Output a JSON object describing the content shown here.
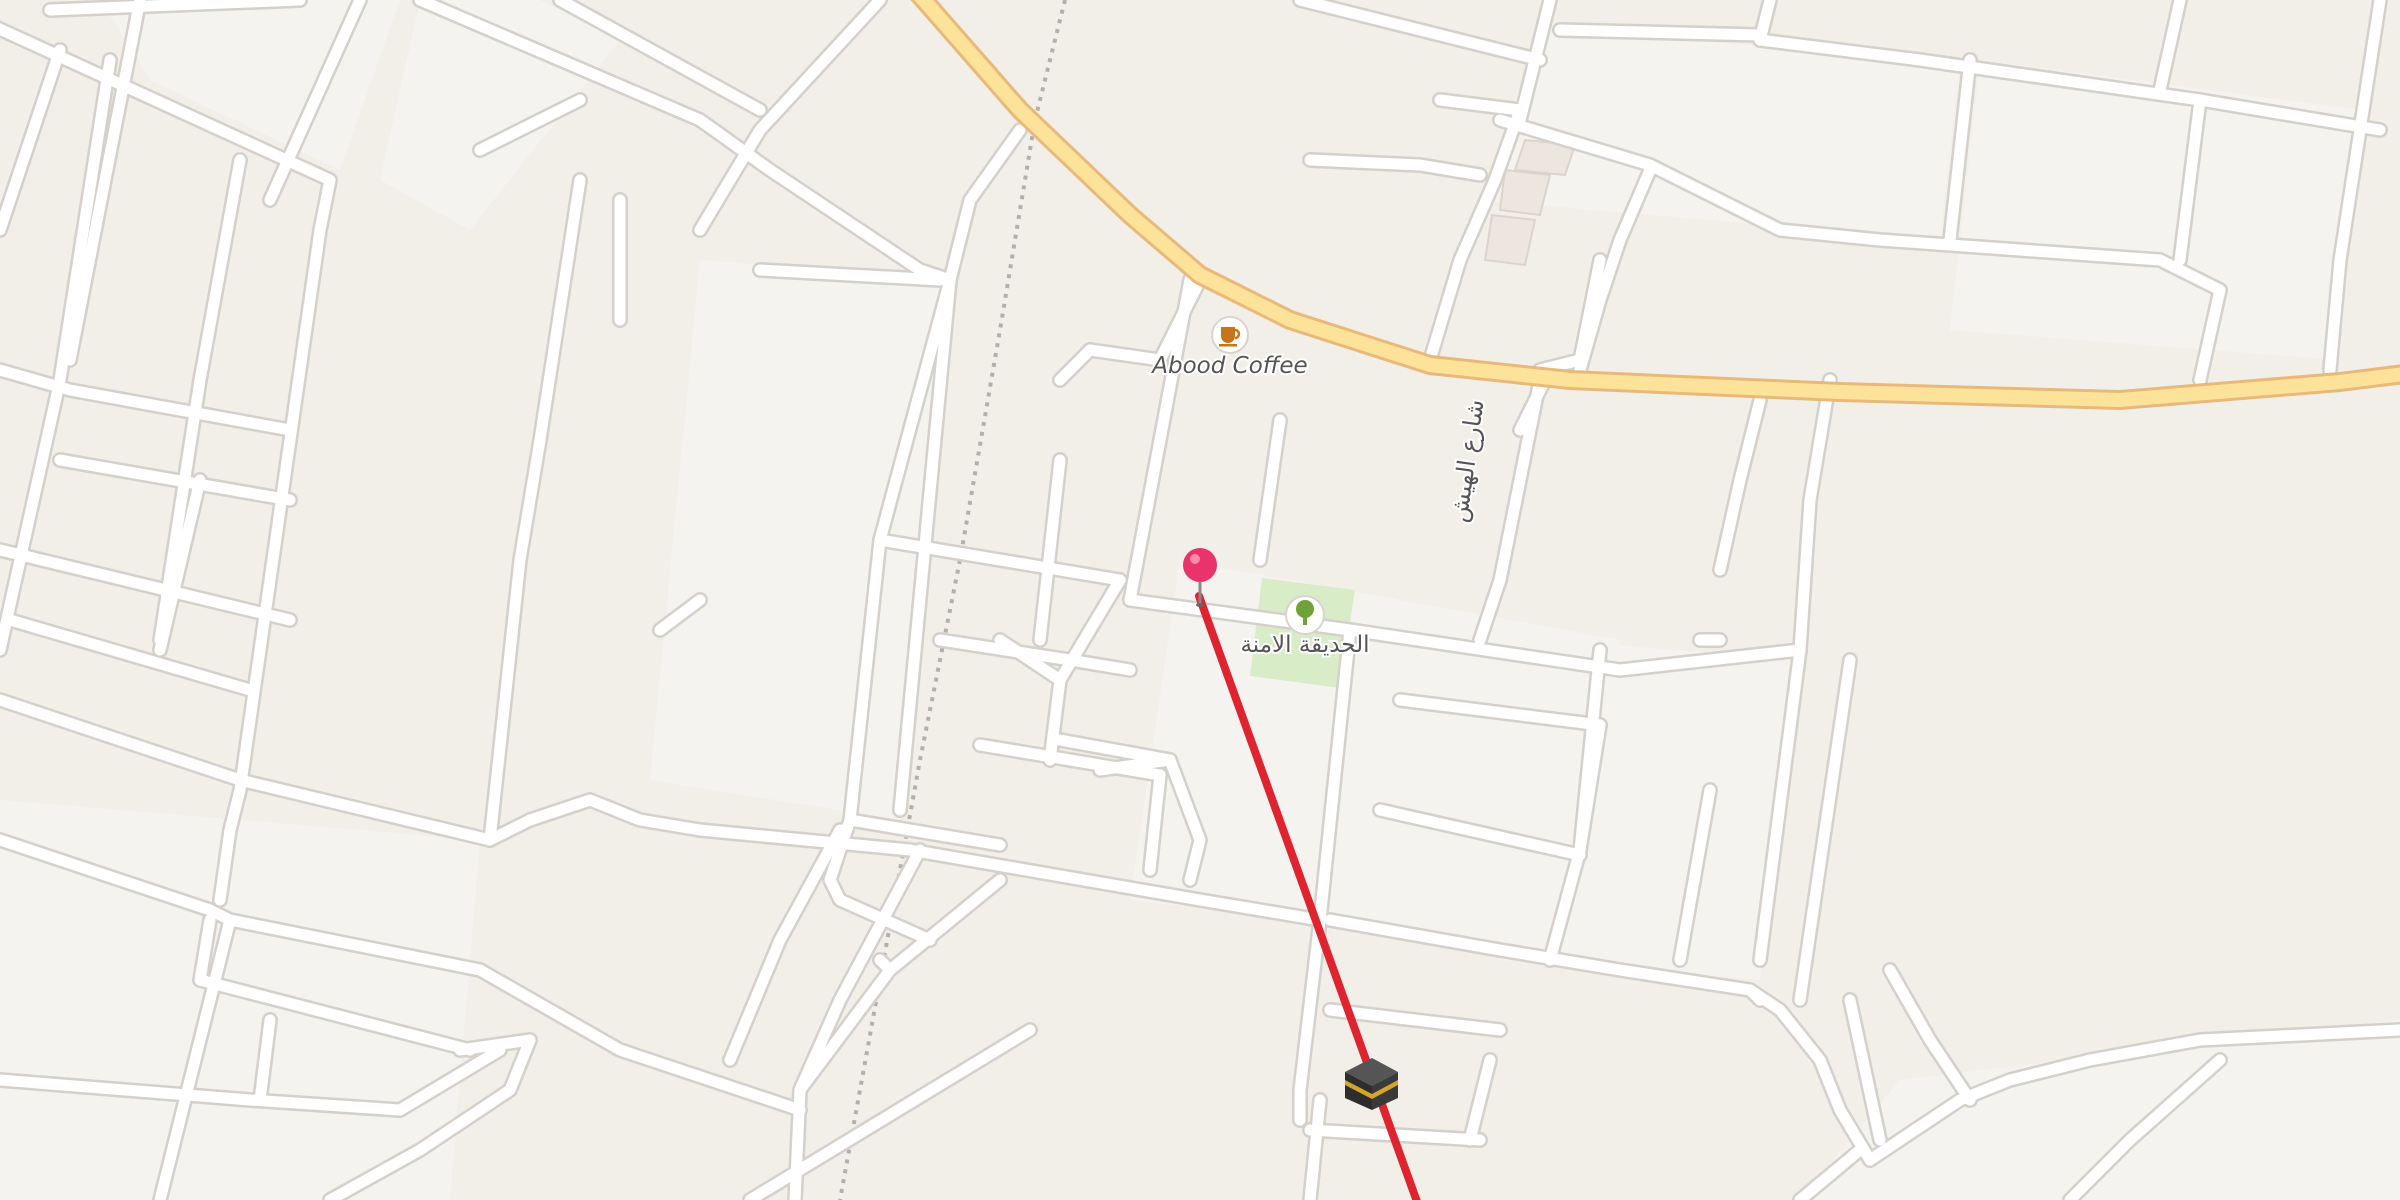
{
  "map": {
    "colors": {
      "background": "#f2efe9",
      "block": "#f5f3f0",
      "minor_road": "#ffffff",
      "minor_road_casing": "#d4d0cb",
      "primary_road": "#fde39a",
      "primary_road_casing": "#e8b97a",
      "railway": "#b3b0ab",
      "park": "#d8ecc8",
      "building": "#ece6df",
      "route_line": "#e0242f",
      "pin": "#e8336b",
      "label_text": "#555555"
    },
    "pois": [
      {
        "name": "Abood Coffee",
        "icon": "coffee-cup-icon"
      },
      {
        "name": "الحديقة الامنة",
        "icon": "tree-icon"
      }
    ],
    "street_labels": [
      {
        "name": "شارع الهيش"
      }
    ],
    "route": {
      "start_marker": "map-pin-icon",
      "destination_marker": "kaaba-icon"
    }
  }
}
